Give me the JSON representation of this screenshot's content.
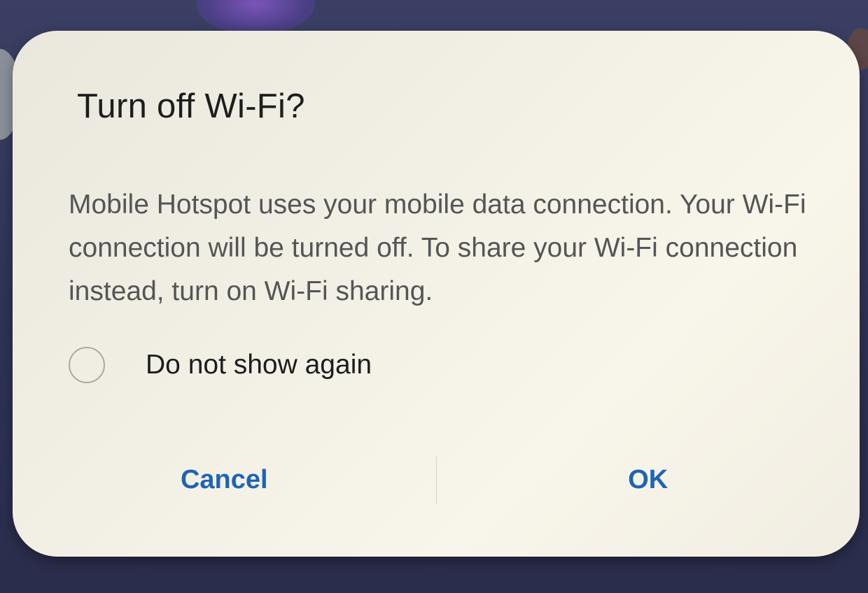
{
  "dialog": {
    "title": "Turn off Wi-Fi?",
    "message": "Mobile Hotspot uses your mobile data connection. Your Wi-Fi connection will be turned off. To share your Wi-Fi connection instead, turn on Wi-Fi sharing.",
    "checkbox": {
      "label": "Do not show again",
      "checked": false
    },
    "buttons": {
      "cancel_label": "Cancel",
      "ok_label": "OK"
    }
  },
  "colors": {
    "accent": "#1f63b5",
    "title_text": "#1d1d1d",
    "body_text": "#555555",
    "dialog_background": "#f3f1e6",
    "screen_background": "#2f3354"
  }
}
